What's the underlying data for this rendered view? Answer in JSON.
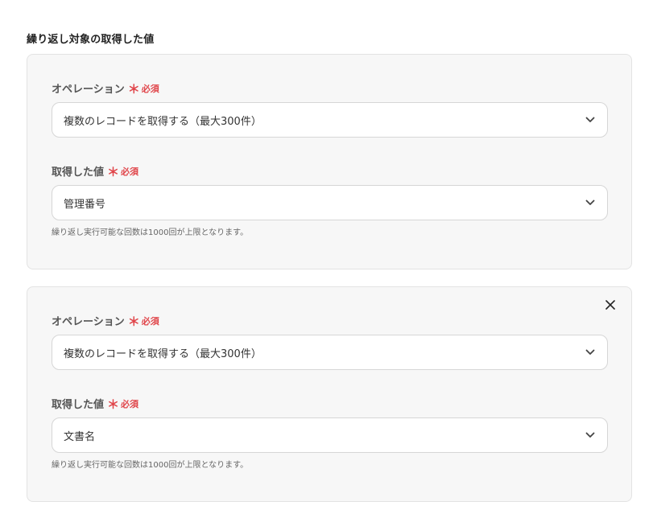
{
  "section": {
    "title": "繰り返し対象の取得した値"
  },
  "groups": [
    {
      "operation": {
        "label": "オペレーション",
        "required_mark": "＊",
        "required_text": "必須",
        "value": "複数のレコードを取得する（最大300件）"
      },
      "acquired_value": {
        "label": "取得した値",
        "required_mark": "＊",
        "required_text": "必須",
        "value": "管理番号"
      },
      "hint": "繰り返し実行可能な回数は1000回が上限となります。"
    },
    {
      "operation": {
        "label": "オペレーション",
        "required_mark": "＊",
        "required_text": "必須",
        "value": "複数のレコードを取得する（最大300件）"
      },
      "acquired_value": {
        "label": "取得した値",
        "required_mark": "＊",
        "required_text": "必須",
        "value": "文書名"
      },
      "hint": "繰り返し実行可能な回数は1000回が上限となります。"
    }
  ],
  "colors": {
    "required": "#e0454a",
    "card_bg": "#f7f7f7",
    "border": "#d6d6d6"
  },
  "icons": {
    "dropdown": "chevron-down-icon",
    "remove": "close-icon"
  }
}
